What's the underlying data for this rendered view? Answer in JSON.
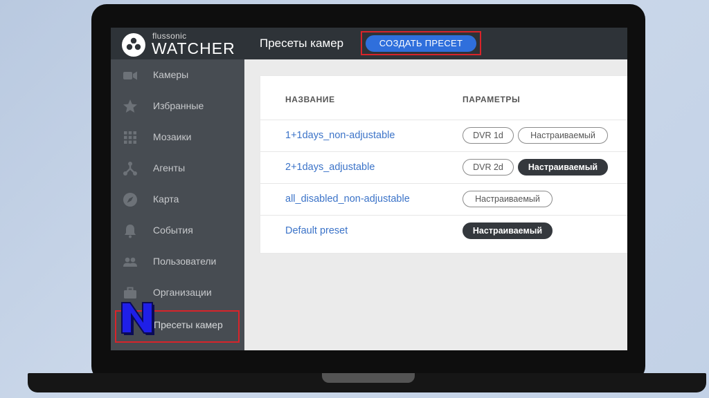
{
  "app": {
    "brand_small": "flussonic",
    "brand_big": "WATCHER"
  },
  "header": {
    "title": "Пресеты камер",
    "create_label": "СОЗДАТЬ ПРЕСЕТ"
  },
  "sidebar": {
    "items": [
      {
        "label": "Камеры",
        "icon": "camera-icon"
      },
      {
        "label": "Избранные",
        "icon": "star-icon"
      },
      {
        "label": "Мозаики",
        "icon": "grid-icon"
      },
      {
        "label": "Агенты",
        "icon": "agents-icon"
      },
      {
        "label": "Карта",
        "icon": "compass-icon"
      },
      {
        "label": "События",
        "icon": "bell-icon"
      },
      {
        "label": "Пользователи",
        "icon": "users-icon"
      },
      {
        "label": "Организации",
        "icon": "briefcase-icon"
      },
      {
        "label": "Пресеты камер",
        "icon": "presets-icon"
      }
    ]
  },
  "table": {
    "columns": [
      "НАЗВАНИЕ",
      "ПАРАМЕТРЫ"
    ],
    "rows": [
      {
        "name": "1+1days_non-adjustable",
        "dvr": "DVR 1d",
        "adjustable": "Настраиваемый",
        "adjustable_active": false
      },
      {
        "name": "2+1days_adjustable",
        "dvr": "DVR 2d",
        "adjustable": "Настраиваемый",
        "adjustable_active": true
      },
      {
        "name": "all_disabled_non-adjustable",
        "dvr": "",
        "adjustable": "Настраиваемый",
        "adjustable_active": false
      },
      {
        "name": "Default preset",
        "dvr": "",
        "adjustable": "Настраиваемый",
        "adjustable_active": true
      }
    ]
  },
  "colors": {
    "accent_blue": "#2f6fdc",
    "link_blue": "#3b73c8",
    "highlight_red": "#d9242a",
    "topbar": "#2e3338",
    "sidebar": "#474c52"
  }
}
